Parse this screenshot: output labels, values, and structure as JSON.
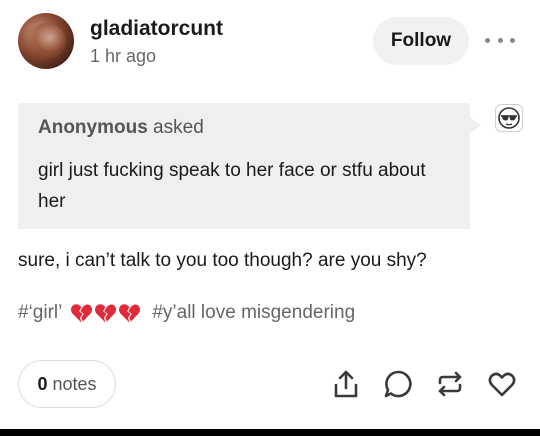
{
  "post": {
    "blog_name": "gladiatorcunt",
    "timestamp": "1 hr ago",
    "follow_label": "Follow"
  },
  "ask": {
    "asker": "Anonymous",
    "asked_label": " asked",
    "question": "girl just fucking speak to her face or stfu about her"
  },
  "answer": {
    "text": "sure, i can’t talk to you too though? are you shy?"
  },
  "tags": [
    {
      "text": "#‘girl’",
      "emoji": "broken-heart-icon x3"
    },
    {
      "text": "#y’all love misgendering"
    }
  ],
  "footer": {
    "notes_count": "0",
    "notes_label": "notes",
    "actions": [
      "share-icon",
      "reply-icon",
      "reblog-icon",
      "like-icon"
    ]
  },
  "colors": {
    "follow_bg": "#f1f1f2",
    "ask_bg": "#efefef",
    "broken_heart": "#e02a3a"
  }
}
